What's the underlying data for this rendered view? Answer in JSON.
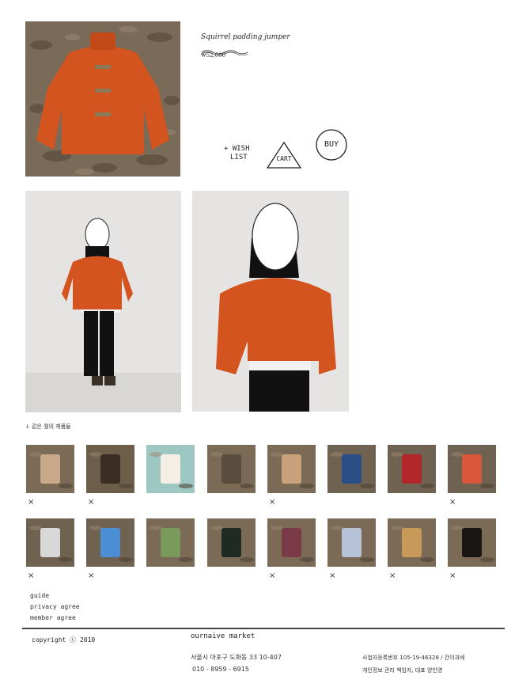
{
  "product": {
    "title": "Squirrel padding jumper",
    "price": "₩52,000"
  },
  "actions": {
    "wishlist_line1": "+ WISH",
    "wishlist_line2": "LIST",
    "cart": "CART",
    "buy": "BUY"
  },
  "related": {
    "heading": "↓ 같은 월의 제품들",
    "sold_mark": "×",
    "items": [
      {
        "name": "knit vest",
        "sold": true
      },
      {
        "name": "boots",
        "sold": true
      },
      {
        "name": "rabbit illustration",
        "sold": false
      },
      {
        "name": "leather bag",
        "sold": false
      },
      {
        "name": "headband",
        "sold": true
      },
      {
        "name": "book",
        "sold": false
      },
      {
        "name": "book",
        "sold": false
      },
      {
        "name": "book",
        "sold": true
      },
      {
        "name": "snow globe",
        "sold": true
      },
      {
        "name": "blue t-shirt",
        "sold": true
      },
      {
        "name": "green shirt",
        "sold": false
      },
      {
        "name": "black jacket",
        "sold": false
      },
      {
        "name": "argyle vest",
        "sold": true
      },
      {
        "name": "deer sweater",
        "sold": true
      },
      {
        "name": "leopard dress",
        "sold": true
      },
      {
        "name": "shoes",
        "sold": true
      }
    ]
  },
  "footer_links": [
    "guide",
    "privacy agree",
    "member agree"
  ],
  "footer": {
    "copyright": "copyright ⓒ 2010",
    "brand": "ournaive market",
    "address": "서울시 마포구 도화동 33 10-407",
    "phone": "010 - 8959 - 6915",
    "biz_line1": "사업자등록번호 105-19-46328 / 간이과세",
    "biz_line2": "개인정보 관리 책임자, 대표 양인영"
  },
  "colors": {
    "jacket": "#d4541f",
    "leaves": "#6b5a48",
    "wall": "#e6e4e2"
  }
}
